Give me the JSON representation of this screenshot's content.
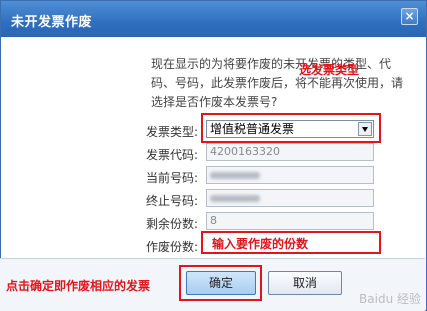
{
  "window": {
    "title": "未开发票作废",
    "close_label": "×"
  },
  "description": "现在显示的为将要作废的未开发票的类型、代码、号码，此发票作废后，将不能再次使用，请选择是否作废本发票号?",
  "annotations": {
    "select_type": "选发票类型",
    "enter_count": "输入要作废的份数",
    "confirm_note": "点击确定即作废相应的发票"
  },
  "fields": {
    "invoice_type": {
      "label": "发票类型:",
      "value": "增值税普通发票"
    },
    "invoice_code": {
      "label": "发票代码:",
      "value": "4200163320"
    },
    "current_number": {
      "label": "当前号码:",
      "value": ""
    },
    "end_number": {
      "label": "终止号码:",
      "value": ""
    },
    "remaining": {
      "label": "剩余份数:",
      "value": "8"
    },
    "void_count": {
      "label": "作废份数:",
      "value": ""
    }
  },
  "buttons": {
    "confirm": "确定",
    "cancel": "取消"
  },
  "watermark": "Baidu 经验"
}
